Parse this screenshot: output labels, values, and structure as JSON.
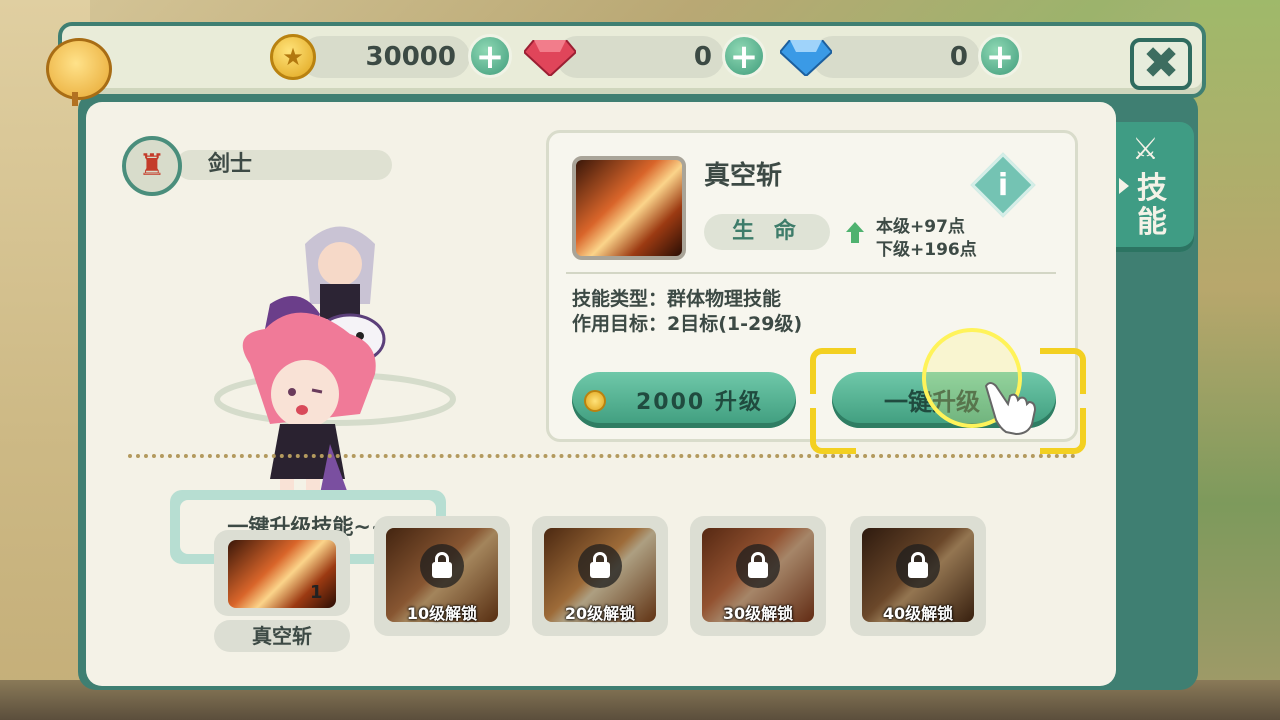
{
  "resources": {
    "gold": {
      "value": "30000",
      "icon": "gold-coin-icon"
    },
    "ruby": {
      "value": "0",
      "icon": "red-gem-icon"
    },
    "diamond": {
      "value": "0",
      "icon": "blue-diamond-icon"
    },
    "plus_label": "+"
  },
  "close_label": "✖",
  "side_tab": {
    "label": "技能",
    "icon": "crossed-swords-icon"
  },
  "character_class": {
    "label": "剑士",
    "icon": "class-emblem-icon"
  },
  "skill": {
    "name": "真空斩",
    "stat_label": "生 命",
    "current_level_bonus": "本级+97点",
    "next_level_bonus": "下级+196点",
    "type": "技能类型：群体物理技能",
    "target": "作用目标：2目标(1-29级)",
    "info_label": "i"
  },
  "buttons": {
    "upgrade": "2000  升级",
    "one_click": "一键升级"
  },
  "tutorial_tip": "一键升级技能~~",
  "slots": [
    {
      "name": "真空斩",
      "level": "1",
      "locked": false
    },
    {
      "label": "10级解锁",
      "locked": true
    },
    {
      "label": "20级解锁",
      "locked": true
    },
    {
      "label": "30级解锁",
      "locked": true
    },
    {
      "label": "40级解锁",
      "locked": true
    }
  ],
  "colors": {
    "accent": "#3f7f72",
    "button": "#4fae8c",
    "highlight": "#f3d021",
    "panel": "#f4f2e7"
  }
}
